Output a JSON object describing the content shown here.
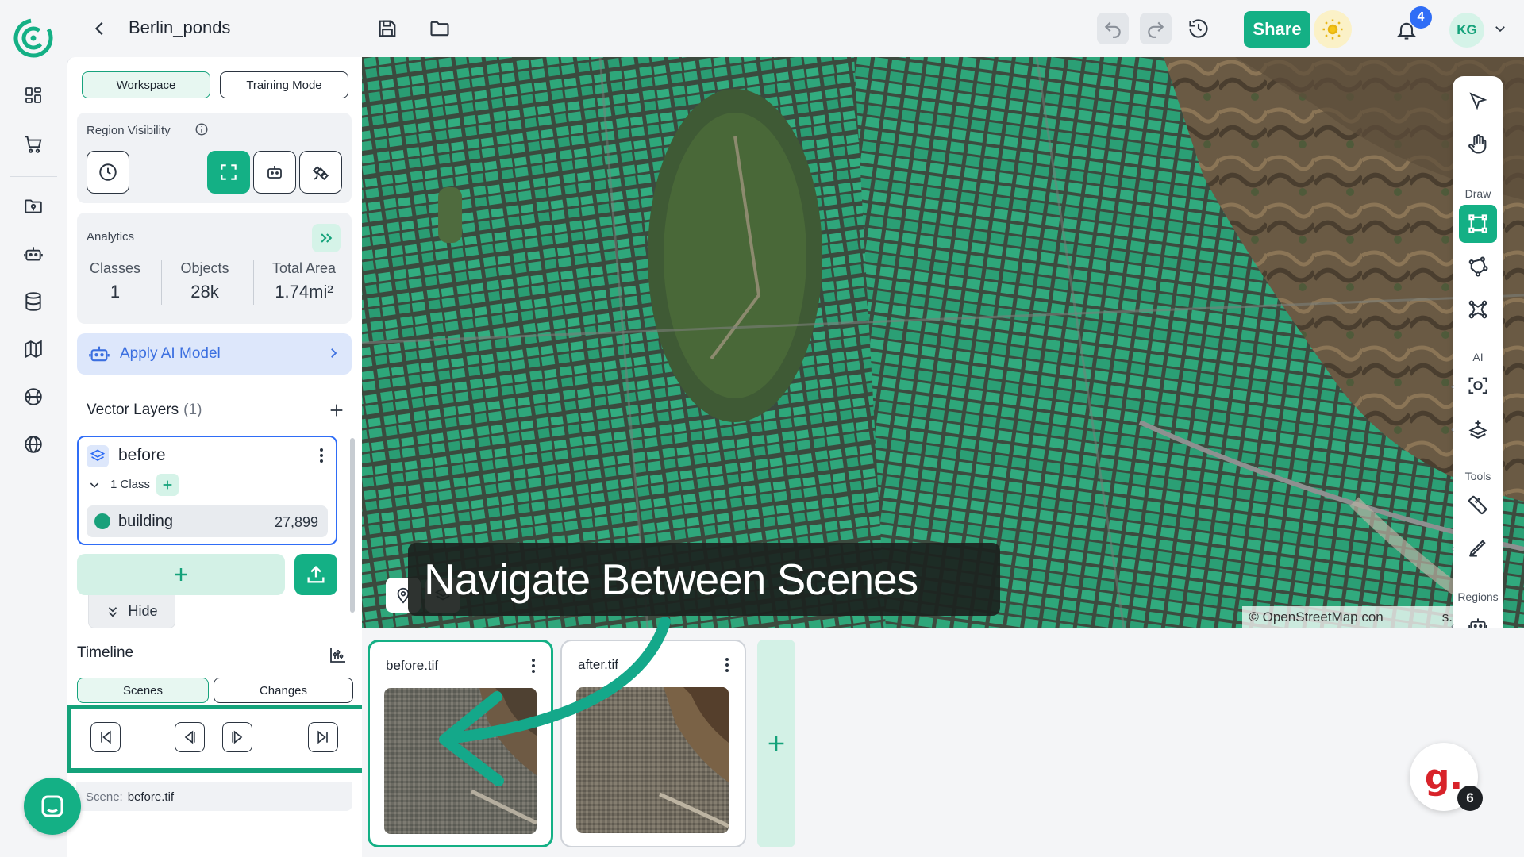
{
  "topbar": {
    "project_title": "Berlin_ponds",
    "share_label": "Share",
    "notification_count": "4",
    "user_initials": "KG"
  },
  "panel": {
    "tabs": [
      {
        "label": "Workspace",
        "active": true
      },
      {
        "label": "Training Mode",
        "active": false
      }
    ],
    "region_visibility": {
      "title": "Region Visibility"
    },
    "analytics": {
      "title": "Analytics",
      "stats": [
        {
          "label": "Classes",
          "value": "1"
        },
        {
          "label": "Objects",
          "value": "28k"
        },
        {
          "label": "Total Area",
          "value": "1.74mi²"
        }
      ]
    },
    "apply_ai_label": "Apply AI Model",
    "vector_layers": {
      "title": "Vector Layers",
      "count": "(1)",
      "layer": {
        "name": "before",
        "class_count": "1 Class",
        "class": {
          "name": "building",
          "count": "27,899",
          "color": "#18a07a"
        }
      }
    },
    "hide_label": "Hide"
  },
  "map": {
    "attribution": "© OpenStreetMap con",
    "attribution_tail": "s."
  },
  "right_toolbar": {
    "labels": {
      "draw": "Draw",
      "ai": "AI",
      "tools": "Tools",
      "regions": "Regions"
    }
  },
  "tooltip": {
    "text": "Navigate Between Scenes"
  },
  "timeline": {
    "title": "Timeline",
    "tabs": [
      {
        "label": "Scenes",
        "active": true
      },
      {
        "label": "Changes",
        "active": false
      }
    ],
    "scene_key": "Scene:",
    "scene_value": "before.tif",
    "scenes": [
      {
        "name": "before.tif",
        "active": true
      },
      {
        "name": "after.tif",
        "active": false
      }
    ]
  },
  "widgets": {
    "g_badge": "6"
  },
  "colors": {
    "accent": "#14b085",
    "blue": "#2f6df6"
  }
}
